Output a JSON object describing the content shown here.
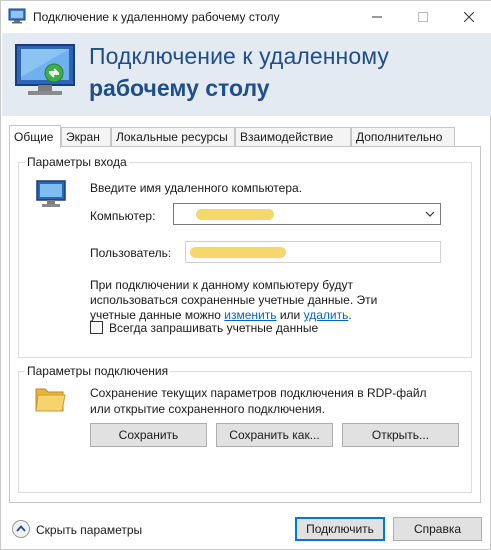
{
  "window": {
    "title": "Подключение к удаленному рабочему столу",
    "controls": {
      "minimize": "—",
      "maximize": "☐",
      "close": "✕"
    }
  },
  "banner": {
    "line1": "Подключение к удаленному",
    "line2": "рабочему столу"
  },
  "tabs": [
    {
      "label": "Общие",
      "active": true
    },
    {
      "label": "Экран",
      "active": false
    },
    {
      "label": "Локальные ресурсы",
      "active": false
    },
    {
      "label": "Взаимодействие",
      "active": false
    },
    {
      "label": "Дополнительно",
      "active": false
    }
  ],
  "logon": {
    "group_title": "Параметры входа",
    "prompt": "Введите имя удаленного компьютера.",
    "computer_label": "Компьютер:",
    "user_label": "Пользователь:",
    "info_line1": "При подключении к данному компьютеру будут",
    "info_line2": "использоваться сохраненные учетные данные.  Эти",
    "info_line3_prefix": "учетные данные можно ",
    "link_change": "изменить",
    "info_line3_mid": " или ",
    "link_delete": "удалить",
    "info_line3_suffix": ".",
    "always_ask_label": "Всегда запрашивать учетные данные",
    "always_ask_checked": false,
    "redaction_color": "#f5d76e"
  },
  "connection": {
    "group_title": "Параметры подключения",
    "desc_line1": "Сохранение текущих параметров подключения в RDP-файл",
    "desc_line2": "или открытие сохраненного подключения.",
    "save_label": "Сохранить",
    "save_as_label": "Сохранить как...",
    "open_label": "Открыть..."
  },
  "footer": {
    "hide_params_label": "Скрыть параметры",
    "connect_label": "Подключить",
    "help_label": "Справка"
  },
  "colors": {
    "banner_bg": "#e4eaf2",
    "banner_text": "#1f4e8c",
    "link": "#0066cc",
    "primary_border": "#0078d7"
  }
}
